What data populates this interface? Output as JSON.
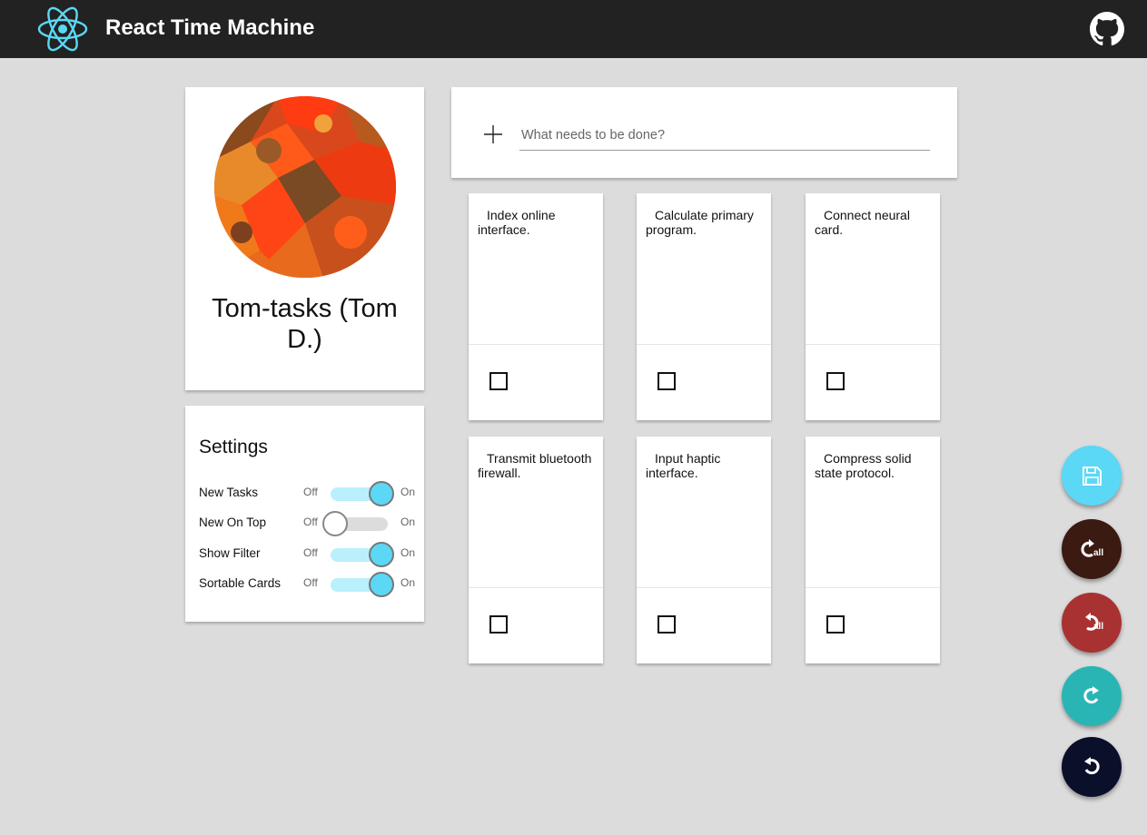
{
  "app": {
    "title": "React Time Machine",
    "logo_icon": "react-atom-icon",
    "github_icon": "github-icon",
    "accent_color": "#5ad8f5"
  },
  "profile": {
    "name": "Tom-tasks (Tom D.)",
    "avatar": "autumn-leaves-avatar"
  },
  "settings": {
    "title": "Settings",
    "off_label": "Off",
    "on_label": "On",
    "toggles": [
      {
        "label": "New Tasks",
        "on": true
      },
      {
        "label": "New On Top",
        "on": false
      },
      {
        "label": "Show Filter",
        "on": true
      },
      {
        "label": "Sortable Cards",
        "on": true
      }
    ]
  },
  "new_task": {
    "placeholder": "What needs to be done?",
    "value": "",
    "icon": "plus-icon"
  },
  "tasks": [
    {
      "text": "Index online interface.",
      "done": false
    },
    {
      "text": "Calculate primary program.",
      "done": false
    },
    {
      "text": "Connect neural card.",
      "done": false
    },
    {
      "text": "Transmit bluetooth firewall.",
      "done": false
    },
    {
      "text": "Input haptic interface.",
      "done": false
    },
    {
      "text": "Compress solid state protocol.",
      "done": false
    }
  ],
  "actions": [
    {
      "name": "save",
      "icon": "save-icon",
      "color": "#5ad8f5"
    },
    {
      "name": "redo-all",
      "icon": "redo-all-icon",
      "color": "#3b1a12",
      "badge": "all"
    },
    {
      "name": "undo-all",
      "icon": "undo-all-icon",
      "color": "#a83232",
      "badge": "all"
    },
    {
      "name": "redo",
      "icon": "redo-icon",
      "color": "#2ab5b5"
    },
    {
      "name": "undo",
      "icon": "undo-icon",
      "color": "#0a0f2a"
    }
  ]
}
